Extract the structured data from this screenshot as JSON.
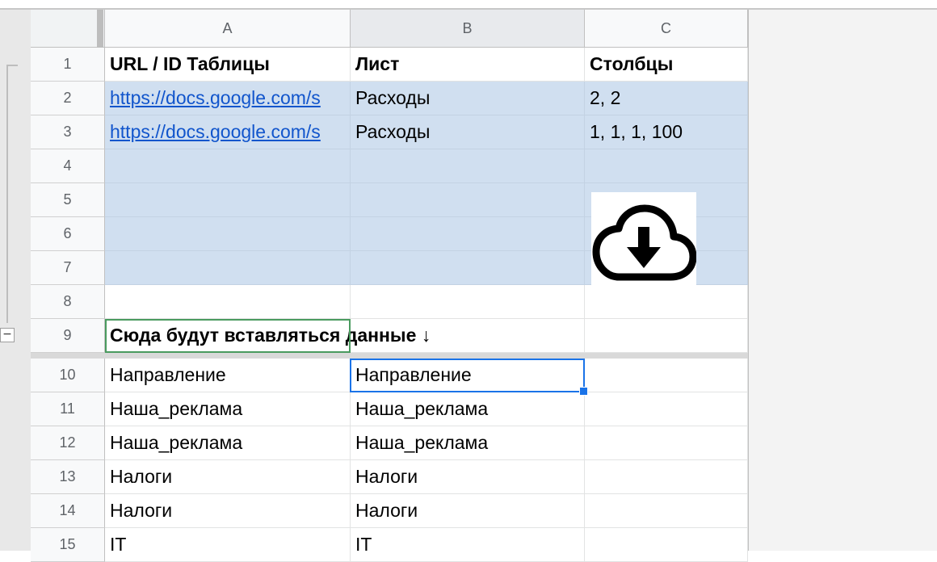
{
  "columns": [
    "A",
    "B",
    "C"
  ],
  "rows": [
    {
      "num": "1",
      "a": "URL / ID Таблицы",
      "b": "Лист",
      "c": "Столбцы"
    },
    {
      "num": "2",
      "a": "https://docs.google.com/s",
      "b": "Расходы",
      "c": "2, 2"
    },
    {
      "num": "3",
      "a": "https://docs.google.com/s",
      "b": "Расходы",
      "c": "1, 1, 1, 100"
    },
    {
      "num": "4",
      "a": "",
      "b": "",
      "c": ""
    },
    {
      "num": "5",
      "a": "",
      "b": "",
      "c": ""
    },
    {
      "num": "6",
      "a": "",
      "b": "",
      "c": ""
    },
    {
      "num": "7",
      "a": "",
      "b": "",
      "c": ""
    },
    {
      "num": "8",
      "a": "",
      "b": "",
      "c": ""
    },
    {
      "num": "9",
      "a": "Сюда будут вставляться данные ↓",
      "b": "",
      "c": ""
    },
    {
      "num": "10",
      "a": "Направление",
      "b": "Направление",
      "c": ""
    },
    {
      "num": "11",
      "a": "Наша_реклама",
      "b": "Наша_реклама",
      "c": ""
    },
    {
      "num": "12",
      "a": "Наша_реклама",
      "b": "Наша_реклама",
      "c": ""
    },
    {
      "num": "13",
      "a": "Налоги",
      "b": "Налоги",
      "c": ""
    },
    {
      "num": "14",
      "a": "Налоги",
      "b": "Налоги",
      "c": ""
    },
    {
      "num": "15",
      "a": "IT",
      "b": "IT",
      "c": ""
    }
  ],
  "group_toggle": "−",
  "download_button": {
    "icon": "cloud-download-icon"
  },
  "colors": {
    "input_fill": "#d0dff0",
    "link": "#1155cc",
    "selection": "#1a73e8",
    "selection_secondary": "#4a9b5f"
  }
}
